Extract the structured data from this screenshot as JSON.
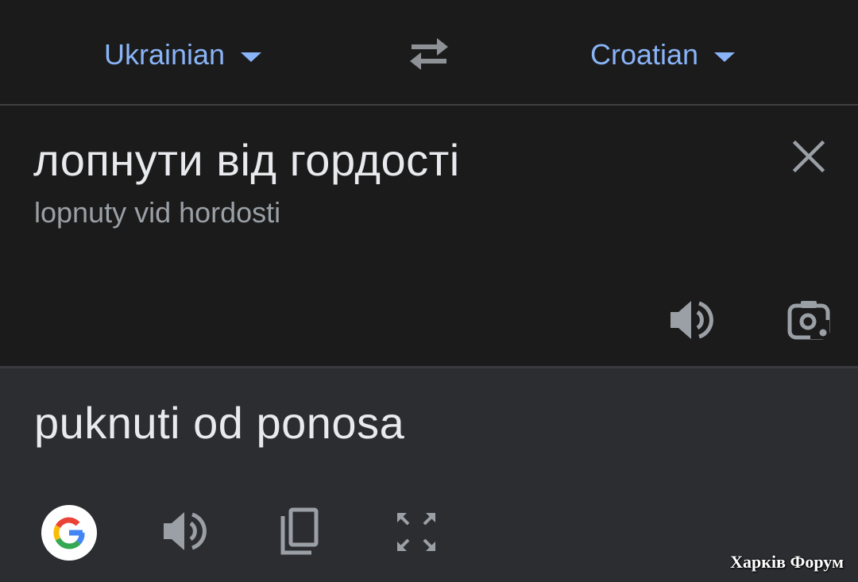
{
  "language_bar": {
    "source_language": "Ukrainian",
    "target_language": "Croatian",
    "swap_icon": "swap-horizontal-icon"
  },
  "source": {
    "text": "лопнути від гордості",
    "transliteration": "lopnuty vid hordosti",
    "icons": [
      "close-icon",
      "speaker-icon",
      "camera-lens-icon"
    ]
  },
  "translation": {
    "text": "puknuti od ponosa",
    "icons": [
      "google-g-icon",
      "speaker-icon",
      "copy-icon",
      "fullscreen-icon"
    ]
  },
  "watermark": "Харків Форум",
  "colors": {
    "background": "#1b1b1b",
    "translation_background": "#2c2d31",
    "accent": "#8ab4f8",
    "text_primary": "#e8eaed",
    "text_secondary": "#9aa0a6",
    "icon": "#9aa0a6"
  }
}
